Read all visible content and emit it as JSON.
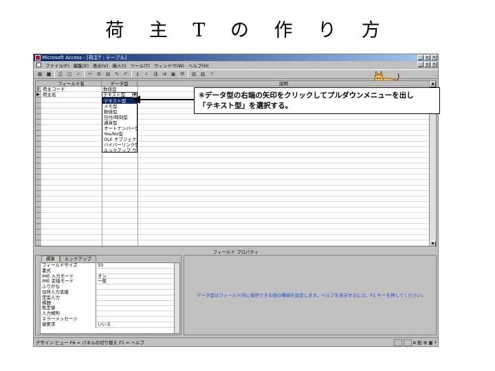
{
  "slide": {
    "title": "荷 主 T の 作 り 方"
  },
  "window": {
    "title": "Microsoft Access - [荷主T : テーブル]",
    "menu": [
      "ファイル(F)",
      "編集(E)",
      "表示(V)",
      "挿入(I)",
      "ツール(T)",
      "ウィンドウ(W)",
      "ヘルプ(H)"
    ]
  },
  "grid": {
    "headers": {
      "field_name": "フィールド名",
      "data_type": "データ型",
      "description": "説明"
    },
    "rows": [
      {
        "name": "荷主コード",
        "type": "数値型"
      },
      {
        "name": "荷主名",
        "type": "テキスト型"
      }
    ],
    "dropdown_options": [
      "テキスト型",
      "メモ型",
      "数値型",
      "日付/時刻型",
      "通貨型",
      "オートナンバー型",
      "Yes/No型",
      "OLE オブジェクト型",
      "ハイパーリンク型",
      "ルックアップ ウィザード"
    ],
    "selected_option": "テキスト型"
  },
  "callout": {
    "line1": "⑥データ型の右端の矢印をクリックしてプルダウンメニューを出し",
    "line2": "「テキスト型」を選択する。"
  },
  "properties": {
    "section_label": "フィールド プロパティ",
    "tabs": [
      "標準",
      "ルックアップ"
    ],
    "rows": [
      {
        "label": "フィールドサイズ",
        "value": "50"
      },
      {
        "label": "書式",
        "value": ""
      },
      {
        "label": "IME 入力モード",
        "value": "オン"
      },
      {
        "label": "IME 変換モード",
        "value": "一般"
      },
      {
        "label": "ふりがな",
        "value": ""
      },
      {
        "label": "住所入力支援",
        "value": ""
      },
      {
        "label": "定型入力",
        "value": ""
      },
      {
        "label": "標題",
        "value": ""
      },
      {
        "label": "既定値",
        "value": ""
      },
      {
        "label": "入力規則",
        "value": ""
      },
      {
        "label": "エラーメッセージ",
        "value": ""
      },
      {
        "label": "値要求",
        "value": "いいえ"
      }
    ],
    "help_text": "データ型はフィールド内に保存できる値の種類を設定します。ヘルプを表示するには、F1 キーを押してください。"
  },
  "status": {
    "text": "デザイン ビュー    F6 = パネルの切り替え    F1 = ヘルプ",
    "ime": "A 般"
  }
}
